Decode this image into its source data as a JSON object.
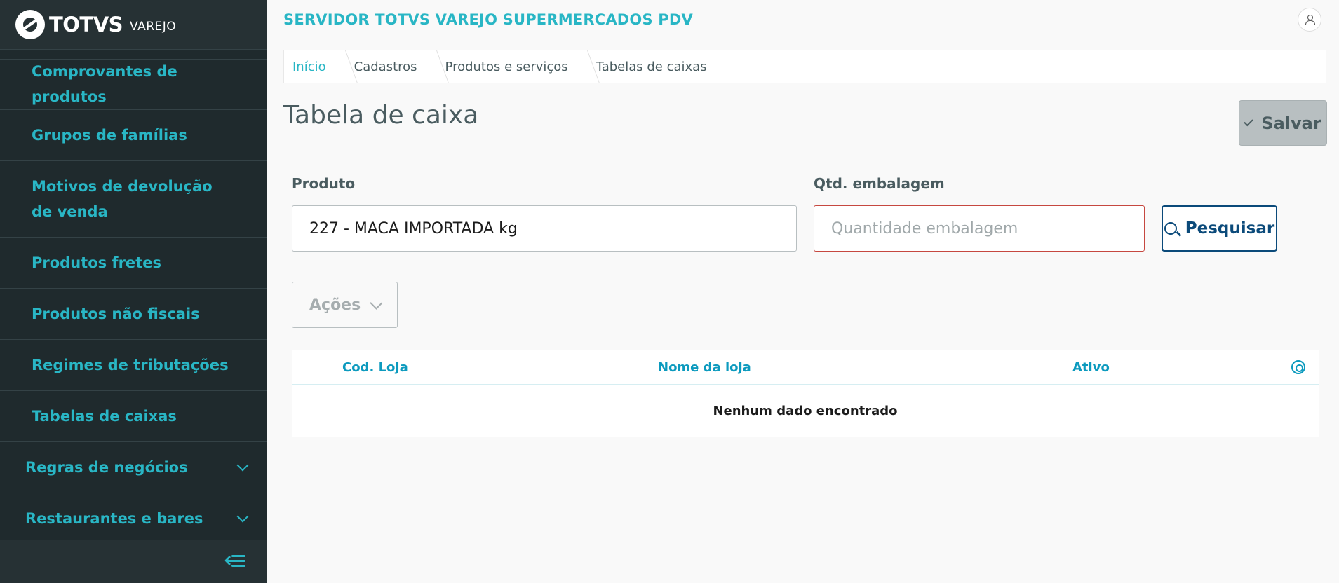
{
  "sidebar": {
    "logo": {
      "brand": "TOTVS",
      "sub": "VAREJO"
    },
    "items": [
      {
        "label": "Comprovantes de produtos"
      },
      {
        "label": "Grupos de famílias"
      },
      {
        "label": "Motivos de devolução de venda"
      },
      {
        "label": "Produtos fretes"
      },
      {
        "label": "Produtos não fiscais"
      },
      {
        "label": "Regimes de tributações"
      },
      {
        "label": "Tabelas de caixas"
      }
    ],
    "groups": [
      {
        "label": "Regras de negócios"
      },
      {
        "label": "Restaurantes e bares"
      }
    ]
  },
  "header": {
    "title": "SERVIDOR TOTVS VAREJO SUPERMERCADOS PDV"
  },
  "breadcrumb": [
    "Início",
    "Cadastros",
    "Produtos e serviços",
    "Tabelas de caixas"
  ],
  "page": {
    "title": "Tabela de caixa",
    "save_label": "Salvar"
  },
  "form": {
    "produto_label": "Produto",
    "produto_value": "227 - MACA IMPORTADA kg",
    "qtd_label": "Qtd. embalagem",
    "qtd_placeholder": "Quantidade embalagem",
    "search_label": "Pesquisar",
    "actions_label": "Ações"
  },
  "table": {
    "columns": [
      "Cod. Loja",
      "Nome da loja",
      "Ativo"
    ],
    "empty_text": "Nenhum dado encontrado"
  },
  "colors": {
    "accent": "#29b6c5",
    "sidebar_bg": "#1f2a2d",
    "primary_dark": "#0b4a7a",
    "error_border": "#c64840"
  }
}
